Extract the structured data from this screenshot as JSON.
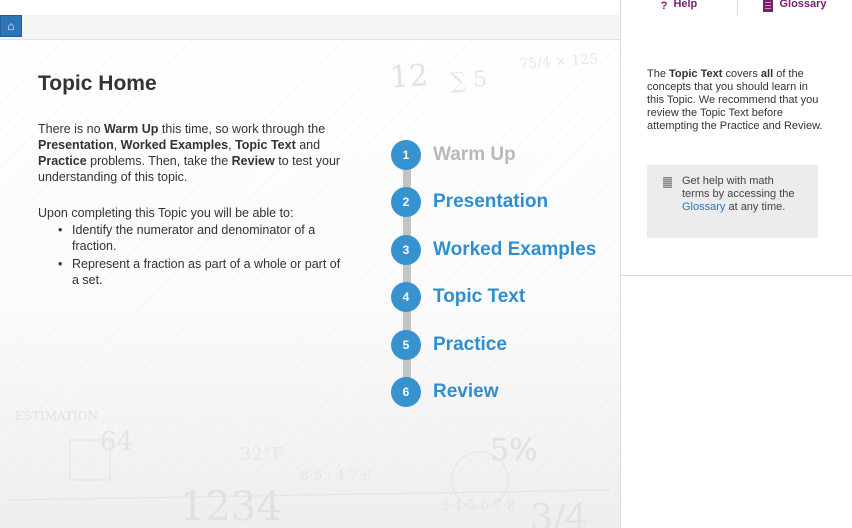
{
  "header": {
    "help_label": "Help",
    "help_icon": "?",
    "glossary_label": "Glossary",
    "glossary_icon": "book-icon",
    "home_icon": "⌂"
  },
  "main": {
    "title": "Topic Home",
    "intro": {
      "p1": "There is no ",
      "warm_up": "Warm Up",
      "p2": " this time, so work through the ",
      "presentation": "Presentation",
      "sep1": ", ",
      "worked_examples": "Worked Examples",
      "sep2": ", ",
      "topic_text": "Topic Text",
      "p3": " and ",
      "practice": "Practice",
      "p4": " problems. Then, take the ",
      "review": "Review",
      "p5": " to test your understanding of this topic."
    },
    "objectives_intro": "Upon completing this Topic you will be able to:",
    "objectives": [
      "Identify the numerator and denominator of a fraction.",
      "Represent a fraction as part of a whole or part of a set."
    ]
  },
  "steps": [
    {
      "num": "1",
      "label": "Warm Up"
    },
    {
      "num": "2",
      "label": "Presentation"
    },
    {
      "num": "3",
      "label": "Worked Examples"
    },
    {
      "num": "4",
      "label": "Topic Text"
    },
    {
      "num": "5",
      "label": "Practice"
    },
    {
      "num": "6",
      "label": "Review"
    }
  ],
  "sidebar": {
    "t1": "The ",
    "topic_text": "Topic Text",
    "t2": " covers ",
    "all": "all",
    "t3": " of the concepts that you should learn in this Topic. We recommend that you review the Topic Text before attempting the Practice and Review.",
    "help": {
      "h1": "Get help with math terms by accessing the ",
      "link": "Glossary",
      "h2": " at any time."
    }
  },
  "colors": {
    "accent_blue": "#3693d0",
    "header_purple": "#7a1e6e",
    "disabled_gray": "#b9b9b9"
  }
}
